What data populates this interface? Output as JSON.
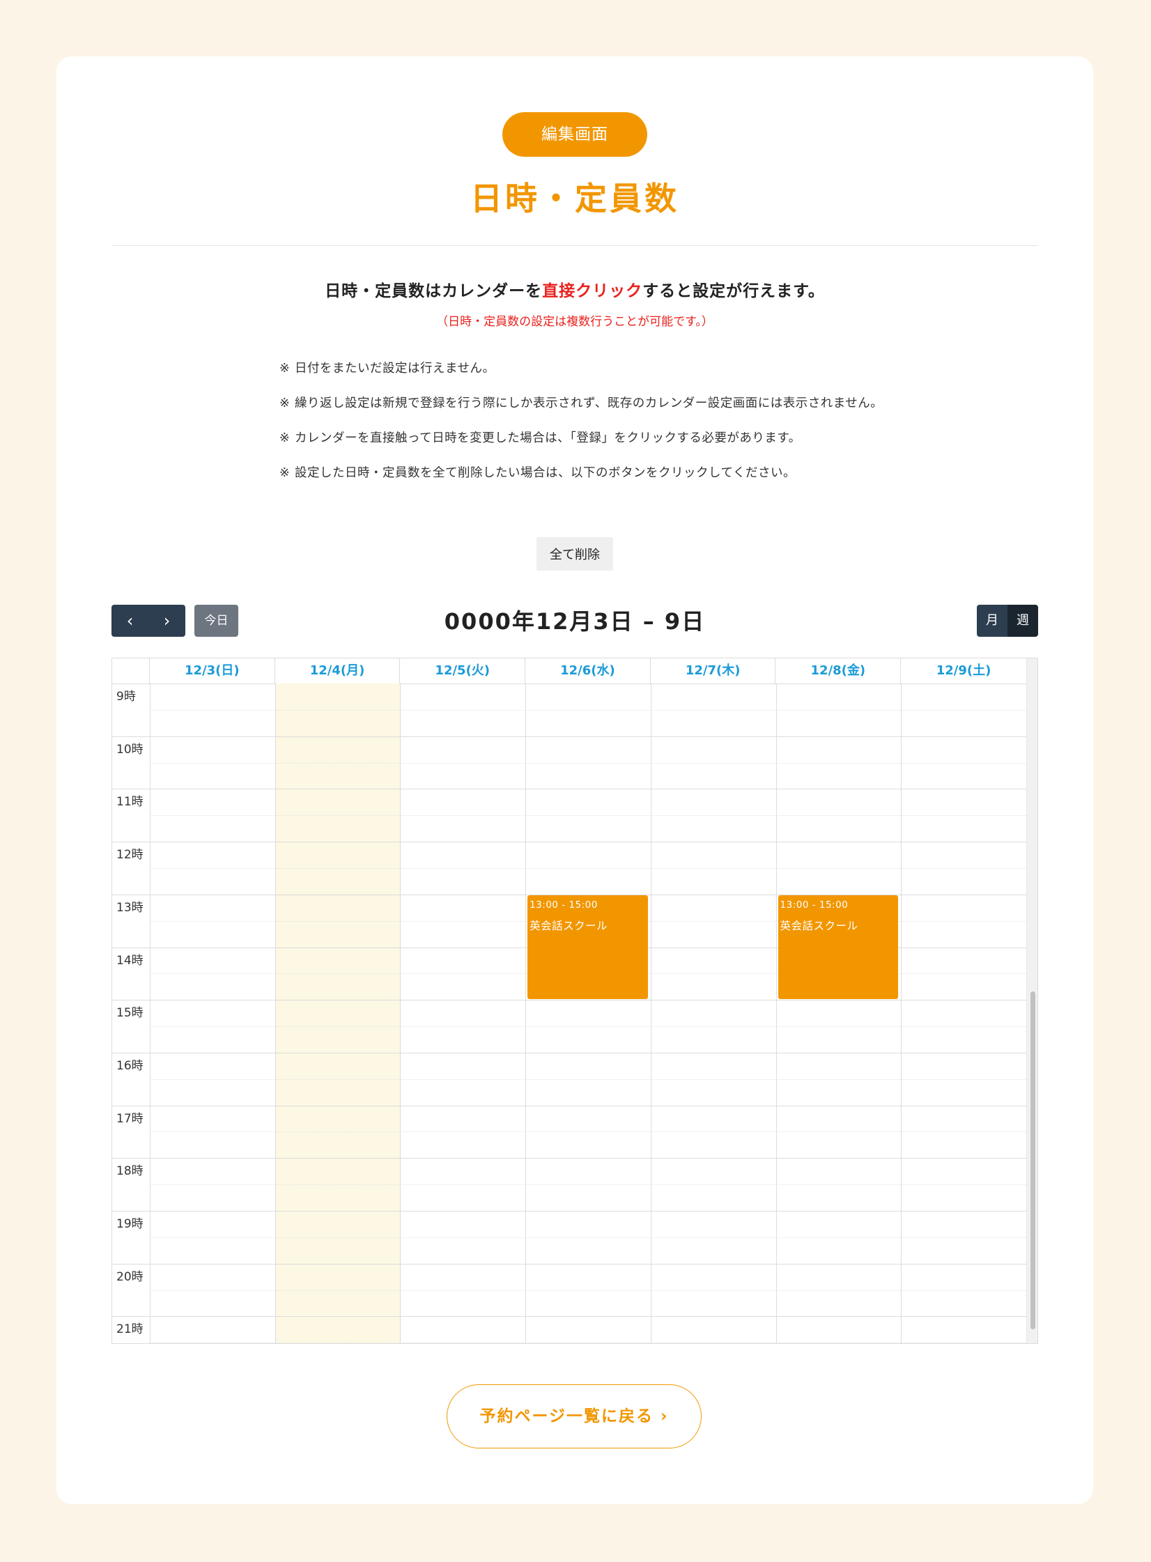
{
  "header": {
    "badge": "編集画面",
    "title": "日時・定員数"
  },
  "intro": {
    "prefix": "日時・定員数はカレンダーを",
    "highlight": "直接クリック",
    "suffix": "すると設定が行えます。",
    "subnote": "（日時・定員数の設定は複数行うことが可能です。）"
  },
  "notes": {
    "mark": "※",
    "items": [
      "日付をまたいだ設定は行えません。",
      "繰り返し設定は新規で登録を行う際にしか表示されず、既存のカレンダー設定画面には表示されません。",
      "カレンダーを直接触って日時を変更した場合は、「登録」をクリックする必要があります。",
      "設定した日時・定員数を全て削除したい場合は、以下のボタンをクリックしてください。"
    ]
  },
  "delete_all_label": "全て削除",
  "calendar": {
    "prev_icon": "chevron-left-icon",
    "next_icon": "chevron-right-icon",
    "prev_glyph": "‹",
    "next_glyph": "›",
    "today_label": "今日",
    "title": "0000年12月3日 – 9日",
    "views": [
      "月",
      "週"
    ],
    "active_view": "週",
    "days": [
      "12/3(日)",
      "12/4(月)",
      "12/5(火)",
      "12/6(水)",
      "12/7(木)",
      "12/8(金)",
      "12/9(土)"
    ],
    "today_index": 1,
    "hours": [
      "9時",
      "10時",
      "11時",
      "12時",
      "13時",
      "14時",
      "15時",
      "16時",
      "17時",
      "18時",
      "19時",
      "20時",
      "21時"
    ],
    "events": [
      {
        "day_index": 3,
        "start": "13:00",
        "end": "15:00",
        "time": "13:00 - 15:00",
        "title": "英会話スクール"
      },
      {
        "day_index": 5,
        "start": "13:00",
        "end": "15:00",
        "time": "13:00 - 15:00",
        "title": "英会話スクール"
      }
    ],
    "colors": {
      "event": "#f29600",
      "today": "#fcf8e3",
      "day_header": "#1a9bd7"
    }
  },
  "back_button": {
    "label": "予約ページ一覧に戻る",
    "icon": "chevron-right-icon",
    "glyph": "›"
  }
}
